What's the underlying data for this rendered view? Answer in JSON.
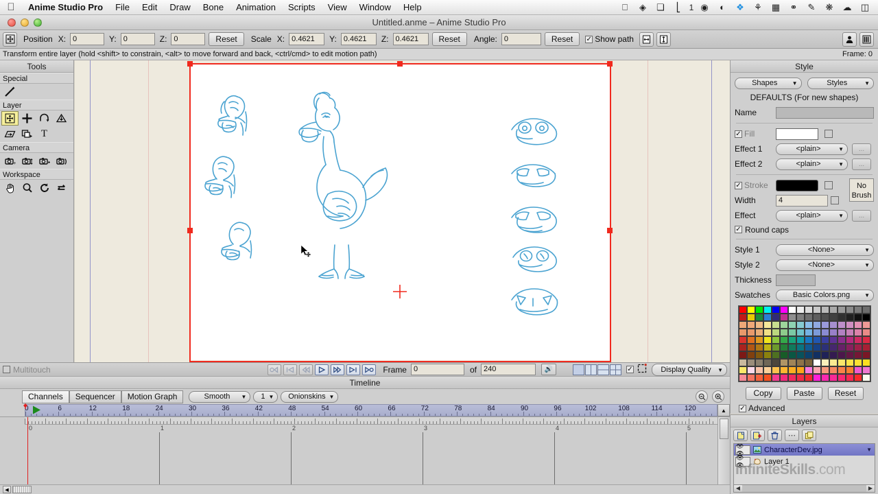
{
  "menubar": {
    "apple_icon": "apple-icon",
    "app_name": "Anime Studio Pro",
    "items": [
      "File",
      "Edit",
      "Draw",
      "Bone",
      "Animation",
      "Scripts",
      "View",
      "Window",
      "Help"
    ],
    "status_icons": [
      "window-icon",
      "clipboard-icon",
      "duplicate-icon",
      "volume-icon",
      "display-number",
      "time-machine-icon",
      "airport-icon",
      "dropbox-icon",
      "bluetooth-icon",
      "screenshot-icon",
      "eject-icon",
      "notes-icon",
      "paw-icon",
      "cloud-icon",
      "battery-icon"
    ],
    "display_number": "1"
  },
  "window": {
    "title": "Untitled.anme – Anime Studio Pro",
    "close_label": "close",
    "minimize_label": "minimize",
    "zoom_label": "zoom"
  },
  "toolbar": {
    "tool_icon": "transform-layer-icon",
    "position_label": "Position",
    "x_label": "X:",
    "y_label": "Y:",
    "z_label": "Z:",
    "position_x": "0",
    "position_y": "0",
    "position_z": "0",
    "reset_position": "Reset",
    "scale_label": "Scale",
    "scale_x": "0.4621",
    "scale_y": "0.4621",
    "scale_z": "0.4621",
    "reset_scale": "Reset",
    "angle_label": "Angle:",
    "angle_value": "0",
    "reset_angle": "Reset",
    "show_path_label": "Show path",
    "show_path_checked": true,
    "flip_h_icon": "flip-horizontal-icon",
    "flip_v_icon": "flip-vertical-icon",
    "person_icon": "person-icon",
    "library_icon": "library-icon"
  },
  "hint": {
    "text": "Transform entire layer (hold <shift> to constrain, <alt> to move forward and back, <ctrl/cmd> to edit motion path)",
    "frame_status": "Frame: 0"
  },
  "tools_panel": {
    "title": "Tools",
    "groups": [
      {
        "name": "Special",
        "tools": [
          {
            "name": "magic-wand-tool",
            "icon": "wand"
          }
        ]
      },
      {
        "name": "Layer",
        "tools": [
          {
            "name": "transform-layer-tool",
            "icon": "transform",
            "selected": true
          },
          {
            "name": "translate-layer-tool",
            "icon": "plus"
          },
          {
            "name": "rotate-layer-tool",
            "icon": "rotate"
          },
          {
            "name": "scale-layer-tool",
            "icon": "scale"
          },
          {
            "name": "shear-layer-tool",
            "icon": "shear"
          },
          {
            "name": "set-origin-tool",
            "icon": "origin"
          },
          {
            "name": "text-tool",
            "icon": "T"
          }
        ]
      },
      {
        "name": "Camera",
        "tools": [
          {
            "name": "track-camera-tool",
            "icon": "cam1"
          },
          {
            "name": "zoom-camera-tool",
            "icon": "cam2"
          },
          {
            "name": "roll-camera-tool",
            "icon": "cam3"
          },
          {
            "name": "pan-tilt-camera-tool",
            "icon": "cam4"
          }
        ]
      },
      {
        "name": "Workspace",
        "tools": [
          {
            "name": "pan-workspace-tool",
            "icon": "hand"
          },
          {
            "name": "zoom-workspace-tool",
            "icon": "magnify"
          },
          {
            "name": "rotate-workspace-tool",
            "icon": "rot"
          },
          {
            "name": "reset-workspace-tool",
            "icon": "reset"
          }
        ]
      }
    ]
  },
  "canvas": {
    "background_color": "#eeeade",
    "page_color": "#ffffff",
    "selection_color": "#f02a1e",
    "sketch_color": "#4aa3d1",
    "guide_blue": "#9294c8",
    "guide_pink": "#e7c2bc",
    "cursor_name": "move-cursor",
    "origin_name": "layer-origin-crosshair"
  },
  "style_panel": {
    "title": "Style",
    "shapes_dropdown": "Shapes",
    "styles_dropdown": "Styles",
    "defaults_text": "DEFAULTS (For new shapes)",
    "name_label": "Name",
    "name_value": "",
    "fill_label": "Fill",
    "fill_checked": true,
    "fill_color": "#ffffff",
    "effect1_label": "Effect 1",
    "effect1_value": "<plain>",
    "effect2_label": "Effect 2",
    "effect2_value": "<plain>",
    "stroke_label": "Stroke",
    "stroke_checked": true,
    "stroke_color": "#000000",
    "no_brush_label": "No Brush",
    "width_label": "Width",
    "width_value": "4",
    "effect_label": "Effect",
    "effect_value": "<plain>",
    "round_caps_label": "Round caps",
    "round_caps_checked": true,
    "style1_label": "Style 1",
    "style1_value": "<None>",
    "style2_label": "Style 2",
    "style2_value": "<None>",
    "thickness_label": "Thickness",
    "thickness_value": "",
    "swatches_label": "Swatches",
    "swatches_value": "Basic Colors.png",
    "copy_label": "Copy",
    "paste_label": "Paste",
    "reset_label": "Reset",
    "advanced_label": "Advanced",
    "advanced_checked": true,
    "ellipsis_label": "...",
    "swatch_colors": [
      "#fe0000",
      "#fefe00",
      "#00e800",
      "#00f0f0",
      "#0000f2",
      "#fe00fe",
      "#ffffff",
      "#ededed",
      "#dcdcdc",
      "#cacaca",
      "#bababa",
      "#a9a9a9",
      "#9a9a9a",
      "#8a8a8a",
      "#7b7b7b",
      "#6d6d6d",
      "#c01818",
      "#e8cc00",
      "#1a8c3a",
      "#2a7fd4",
      "#302a78",
      "#c03090",
      "#8f8f8f",
      "#7f7f7f",
      "#6e6e6e",
      "#5e5e5e",
      "#4f4f4f",
      "#404040",
      "#303030",
      "#202020",
      "#101010",
      "#000000",
      "#efa878",
      "#efa878",
      "#eeba86",
      "#f5e79a",
      "#c8de8e",
      "#9ed59c",
      "#8ed3b2",
      "#86cbd1",
      "#8bbde8",
      "#8fa9e0",
      "#9a9ada",
      "#a68fd0",
      "#bd8fcb",
      "#cf8fc2",
      "#e391b4",
      "#ef9a96",
      "#e8996b",
      "#e8996b",
      "#e9ad77",
      "#f1df85",
      "#bbd77e",
      "#8ecc8c",
      "#7bc9a5",
      "#70c2cb",
      "#74b2e3",
      "#7c9bd9",
      "#8a8bd2",
      "#9880c9",
      "#b280c2",
      "#c780b8",
      "#dc82aa",
      "#e98b87",
      "#d9342e",
      "#e0701f",
      "#e09a1f",
      "#f0e41e",
      "#8cc63e",
      "#34a94a",
      "#19a37a",
      "#109ba8",
      "#1877c4",
      "#2257b0",
      "#3a3fa0",
      "#5e3394",
      "#8a2f8c",
      "#b42a7e",
      "#cf2a63",
      "#d92a45",
      "#a9231f",
      "#b05714",
      "#b07814",
      "#bfb314",
      "#6d9a2d",
      "#248038",
      "#107a5c",
      "#0a7480",
      "#105a94",
      "#184286",
      "#2c3078",
      "#46276e",
      "#672168",
      "#88205e",
      "#9e2049",
      "#a62034",
      "#7c1916",
      "#80400e",
      "#80580e",
      "#8a810e",
      "#4e7021",
      "#185c28",
      "#0a5743",
      "#08525c",
      "#0c416c",
      "#123062",
      "#1f2257",
      "#331b50",
      "#4b174b",
      "#631744",
      "#741735",
      "#7a1726",
      "#c9b99e",
      "#9a8d7a",
      "#8a7f6d",
      "#6f6657",
      "#4c463c",
      "#b09565",
      "#a08457",
      "#8e7349",
      "#7c633c",
      "#ffffff",
      "#fbf0bb",
      "#fbeb92",
      "#fae86a",
      "#fae447",
      "#fbe232",
      "#fbe020",
      "#fae86a",
      "#fbd9ea",
      "#f8c2a8",
      "#f9cf9a",
      "#fbc14e",
      "#fcb631",
      "#fcae22",
      "#fca41a",
      "#f77ae0",
      "#f8a8b0",
      "#f79a7c",
      "#f88a62",
      "#f98248",
      "#f98030",
      "#f05ad0",
      "#f078d0",
      "#f58a96",
      "#f5725f",
      "#f4603a",
      "#f3501f",
      "#f23c90",
      "#f22a7c",
      "#f12a5e",
      "#f02a46",
      "#f02a32",
      "#ff20d8",
      "#fb28b0",
      "#fa2896",
      "#fa2872",
      "#fa2850",
      "#f92a2a",
      "#fbfbef"
    ]
  },
  "layers_panel": {
    "title": "Layers",
    "buttons": [
      "new-layer-button",
      "new-group-button",
      "delete-layer-button",
      "more-options-button",
      "duplicate-layer-button"
    ],
    "layers": [
      {
        "name": "CharacterDev.jpg",
        "type": "image-layer",
        "visible": true,
        "selected": true
      },
      {
        "name": "Layer 1",
        "type": "vector-layer",
        "visible": true,
        "selected": false
      }
    ],
    "watermark_main": "InfiniteSkills",
    "watermark_suffix": ".com"
  },
  "playbar": {
    "multitouch_label": "Multitouch",
    "multitouch_checked": false,
    "buttons": [
      {
        "name": "go-to-start-button",
        "glyph": "|◁"
      },
      {
        "name": "previous-keyframe-button",
        "glyph": "◁|"
      },
      {
        "name": "step-back-button",
        "glyph": "◁◁"
      },
      {
        "name": "play-button",
        "glyph": "▷"
      },
      {
        "name": "fast-forward-button",
        "glyph": "▷▷"
      },
      {
        "name": "next-keyframe-button",
        "glyph": "▷|"
      },
      {
        "name": "go-to-end-button",
        "glyph": "▷○"
      }
    ],
    "frame_label": "Frame",
    "frame_value": "0",
    "of_label": "of",
    "total_frames": "240",
    "sound_icon": "speaker-icon",
    "view_modes": [
      "single-view",
      "two-column-view",
      "two-row-view",
      "quad-view"
    ],
    "extra_checked": true,
    "crop_icon": "crop-icon",
    "display_quality": "Display Quality"
  },
  "timeline": {
    "title": "Timeline",
    "tabs": [
      "Channels",
      "Sequencer",
      "Motion Graph"
    ],
    "active_tab": "Channels",
    "interpolation": "Smooth",
    "onion_count": "1",
    "onionskins": "Onionskins",
    "zoom_out_icon": "zoom-out-icon",
    "zoom_in_icon": "zoom-in-icon",
    "frame_ticks": [
      "0",
      "6",
      "12",
      "18",
      "24",
      "30",
      "36",
      "42",
      "48",
      "54",
      "60",
      "66",
      "72",
      "78",
      "84",
      "90",
      "96",
      "102",
      "108",
      "114",
      "120"
    ],
    "second_marks": [
      "0",
      "1",
      "2",
      "3",
      "4",
      "5"
    ],
    "playhead_frame": "0"
  }
}
